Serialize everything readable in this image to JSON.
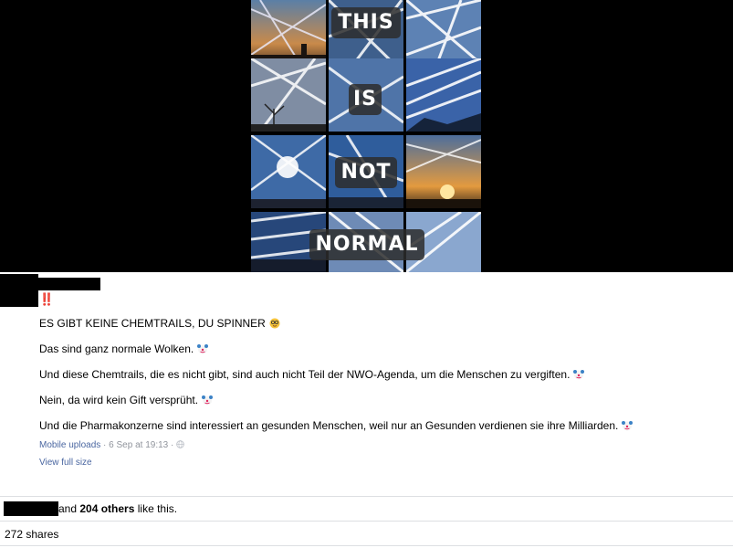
{
  "photo": {
    "overlay_words": [
      "THIS",
      "IS",
      "NOT",
      "NORMAL"
    ]
  },
  "post": {
    "alert_emoji": "‼️",
    "lines": [
      "ES GIBT KEINE CHEMTRAILS, DU SPINNER",
      "Das sind ganz normale Wolken.",
      "Und diese Chemtrails, die es nicht gibt, sind auch nicht Teil der NWO-Agenda, um die Menschen zu vergiften.",
      "Nein, da wird kein Gift versprüht.",
      "Und die Pharmakonzerne sind interessiert an gesunden Menschen, weil nur an Gesunden verdienen sie ihre Milliarden."
    ],
    "line_emojis": [
      "nerd-face-icon",
      "clown-face-icon",
      "clown-face-icon",
      "clown-face-icon",
      "clown-face-icon"
    ]
  },
  "meta": {
    "source": "Mobile uploads",
    "separator": "·",
    "timestamp": "6 Sep at 19:13",
    "audience_icon": "globe-icon"
  },
  "view_full_size": "View full size",
  "likes": {
    "prefix": "and",
    "count_text": "204 others",
    "suffix": "like this."
  },
  "shares": "272 shares",
  "colors": {
    "link": "#4b67a1",
    "meta_gray": "#90949c",
    "photo_bg": "#000000",
    "alert_red": "#e0245e"
  }
}
